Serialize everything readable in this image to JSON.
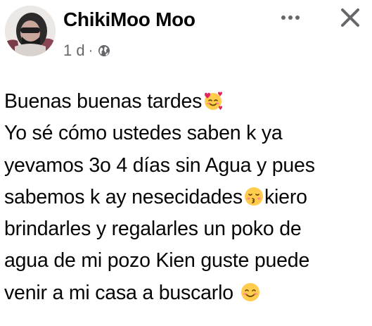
{
  "post": {
    "author": {
      "name": "ChikiMoo Moo",
      "avatar_icon": "profile-photo"
    },
    "meta": {
      "time": "1 d",
      "separator": "·",
      "audience_icon": "globe-icon"
    },
    "actions": {
      "more_icon": "more-horizontal-icon",
      "more_label": "···",
      "close_icon": "close-icon",
      "close_label": "✕"
    },
    "body": {
      "lines": [
        {
          "text": "Buenas buenas tardes",
          "emoji": "smiling-face-with-hearts"
        },
        {
          "text": "Yo sé cómo ustedes saben k ya"
        },
        {
          "text": "yevamos 3o 4 días sin Agua y pues"
        },
        {
          "text": "sabemos k ay nesecidades",
          "emoji": "kissing-face-with-closed-eyes",
          "after": "kiero"
        },
        {
          "text": "brindarles y regalarles un poko de"
        },
        {
          "text": "agua de mi pozo Kien guste puede"
        },
        {
          "text": "venir a mi casa a buscarlo ",
          "emoji": "smiling-face-with-smiling-eyes"
        }
      ]
    },
    "colors": {
      "text": "#050505",
      "secondary": "#65676b",
      "emoji_yellow": "#ffcc4d",
      "emoji_heart": "#e0245e"
    }
  }
}
